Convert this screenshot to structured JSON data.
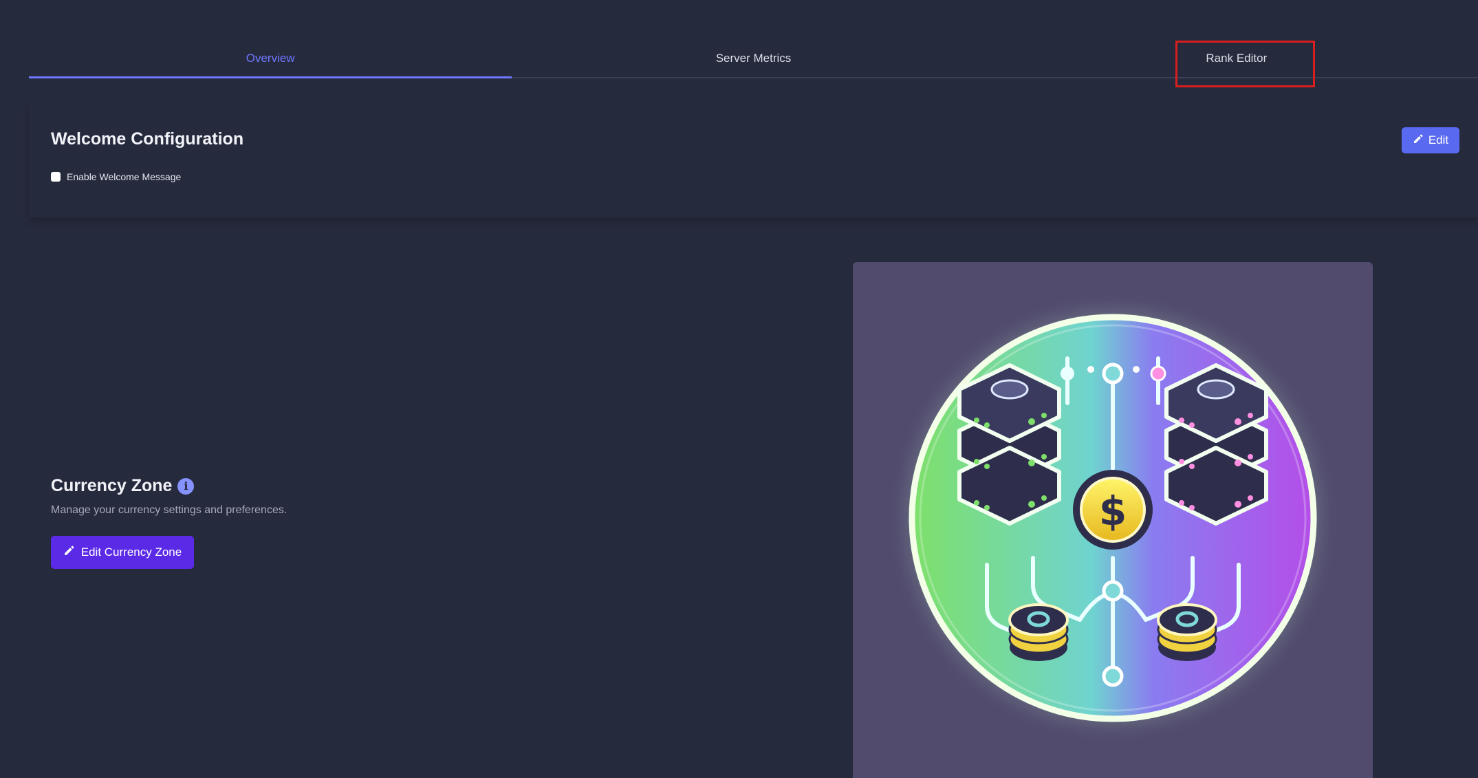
{
  "tabs": [
    {
      "label": "Overview",
      "active": true
    },
    {
      "label": "Server Metrics",
      "active": false
    },
    {
      "label": "Rank Editor",
      "active": false
    }
  ],
  "welcome": {
    "title": "Welcome Configuration",
    "edit_label": "Edit",
    "checkbox_label": "Enable Welcome Message",
    "checkbox_checked": false
  },
  "currency": {
    "title": "Currency Zone",
    "description": "Manage your currency settings and preferences.",
    "button_label": "Edit Currency Zone",
    "illustration_icon": "server-coin-emblem"
  },
  "colors": {
    "background": "#262a3d",
    "accent": "#6e78ff",
    "edit_button": "#5a6af0",
    "currency_button": "#5b2ae6",
    "highlight": "#d81e1e"
  }
}
